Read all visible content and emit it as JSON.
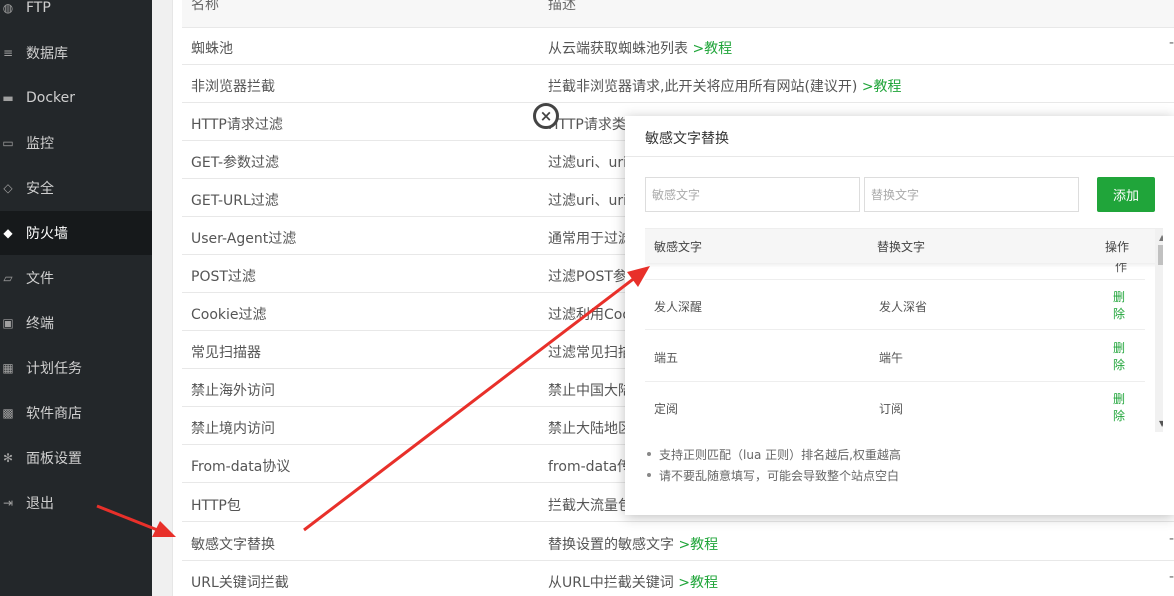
{
  "sidebar": {
    "items": [
      {
        "label": "FTP",
        "icon": "globe-icon",
        "active": false
      },
      {
        "label": "数据库",
        "icon": "database-icon",
        "active": false
      },
      {
        "label": "Docker",
        "icon": "docker-icon",
        "active": false
      },
      {
        "label": "监控",
        "icon": "monitor-icon",
        "active": false
      },
      {
        "label": "安全",
        "icon": "shield-icon",
        "active": false
      },
      {
        "label": "防火墙",
        "icon": "firewall-shield-icon",
        "active": true
      },
      {
        "label": "文件",
        "icon": "folder-icon",
        "active": false
      },
      {
        "label": "终端",
        "icon": "terminal-icon",
        "active": false
      },
      {
        "label": "计划任务",
        "icon": "calendar-icon",
        "active": false
      },
      {
        "label": "软件商店",
        "icon": "grid-icon",
        "active": false
      },
      {
        "label": "面板设置",
        "icon": "gear-icon",
        "active": false
      },
      {
        "label": "退出",
        "icon": "logout-icon",
        "active": false
      }
    ]
  },
  "table": {
    "headers": {
      "name": "名称",
      "desc": "描述"
    },
    "rows": [
      {
        "name": "蜘蛛池",
        "desc": "从云端获取蜘蛛池列表",
        "link": ">教程"
      },
      {
        "name": "非浏览器拦截",
        "desc": "拦截非浏览器请求,此开关将应用所有网站(建议开)",
        "link": ">教程"
      },
      {
        "name": "HTTP请求过滤",
        "desc": "HTTP请求类",
        "link": ""
      },
      {
        "name": "GET-参数过滤",
        "desc": "过滤uri、uri",
        "link": ""
      },
      {
        "name": "GET-URL过滤",
        "desc": "过滤uri、uri",
        "link": ""
      },
      {
        "name": "User-Agent过滤",
        "desc": "通常用于过滤",
        "link": ""
      },
      {
        "name": "POST过滤",
        "desc": "过滤POST参",
        "link": ""
      },
      {
        "name": "Cookie过滤",
        "desc": "过滤利用Coo",
        "link": ""
      },
      {
        "name": "常见扫描器",
        "desc": "过滤常见扫描",
        "link": ""
      },
      {
        "name": "禁止海外访问",
        "desc": "禁止中国大陆",
        "link": ""
      },
      {
        "name": "禁止境内访问",
        "desc": "禁止大陆地区",
        "link": ""
      },
      {
        "name": "From-data协议",
        "desc": "from-data传",
        "link": ""
      },
      {
        "name": "HTTP包",
        "desc": "拦截大流量包",
        "link": ""
      },
      {
        "name": "敏感文字替换",
        "desc": "替换设置的敏感文字",
        "link": ">教程"
      },
      {
        "name": "URL关键词拦截",
        "desc": "从URL中拦截关键词",
        "link": ">教程"
      }
    ],
    "dash": "-"
  },
  "modal": {
    "title": "敏感文字替换",
    "close_label": "×",
    "word_placeholder": "敏感文字",
    "replace_placeholder": "替换文字",
    "add_label": "添加",
    "headers": {
      "word": "敏感文字",
      "replace": "替换文字",
      "op": "操作"
    },
    "partial_op": "作",
    "rows": [
      {
        "word": "发人深醒",
        "replace": "发人深省",
        "del1": "删",
        "del2": "除"
      },
      {
        "word": "端五",
        "replace": "端午",
        "del1": "删",
        "del2": "除"
      },
      {
        "word": "定阅",
        "replace": "订阅",
        "del1": "删",
        "del2": "除"
      }
    ],
    "scroll_up": "▲",
    "scroll_down": "▼",
    "tips": [
      "支持正则匹配（lua 正则）排名越后,权重越高",
      "请不要乱随意填写，可能会导致整个站点空白"
    ]
  },
  "colors": {
    "accent": "#20a53a",
    "sidebar": "#23272a",
    "arrow": "#e8302a"
  }
}
